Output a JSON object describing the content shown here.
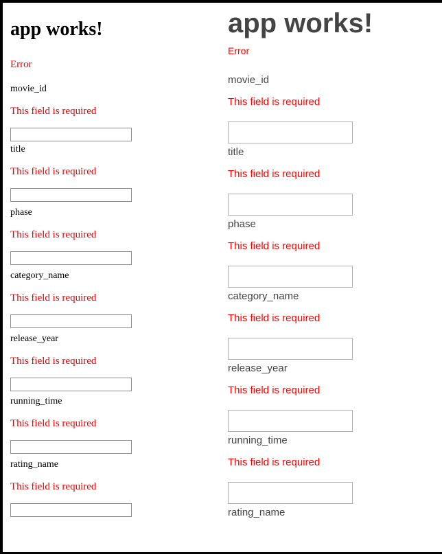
{
  "left_panel": {
    "title": "app works!",
    "error": "Error",
    "fields": [
      {
        "label": "movie_id",
        "error": "This field is required",
        "value": ""
      },
      {
        "label": "title",
        "error": "This field is required",
        "value": ""
      },
      {
        "label": "phase",
        "error": "This field is required",
        "value": ""
      },
      {
        "label": "category_name",
        "error": "This field is required",
        "value": ""
      },
      {
        "label": "release_year",
        "error": "This field is required",
        "value": ""
      },
      {
        "label": "running_time",
        "error": "This field is required",
        "value": ""
      },
      {
        "label": "rating_name",
        "error": "This field is required",
        "value": ""
      }
    ]
  },
  "right_panel": {
    "title": "app works!",
    "error": "Error",
    "fields": [
      {
        "label": "movie_id",
        "error": "This field is required",
        "value": ""
      },
      {
        "label": "title",
        "error": "This field is required",
        "value": ""
      },
      {
        "label": "phase",
        "error": "This field is required",
        "value": ""
      },
      {
        "label": "category_name",
        "error": "This field is required",
        "value": ""
      },
      {
        "label": "release_year",
        "error": "This field is required",
        "value": ""
      },
      {
        "label": "running_time",
        "error": "This field is required",
        "value": ""
      },
      {
        "label": "rating_name",
        "error": "",
        "value": ""
      }
    ]
  },
  "colors": {
    "error": "#ff0000",
    "frame": "#000000"
  }
}
